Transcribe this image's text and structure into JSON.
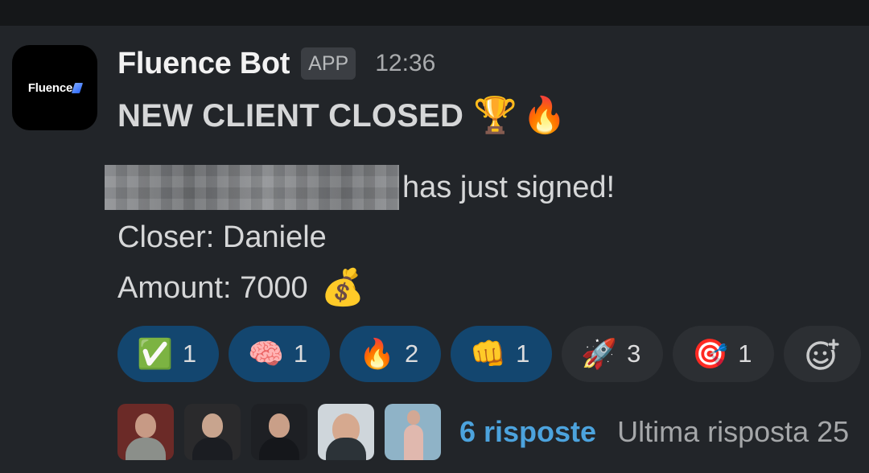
{
  "message": {
    "logo_text": "Fluence",
    "sender": "Fluence Bot",
    "badge": "APP",
    "time": "12:36",
    "headline": "NEW CLIENT CLOSED",
    "headline_emojis": [
      "🏆",
      "🔥"
    ],
    "signed_text": "has just signed!",
    "closer_line": "Closer: Daniele",
    "amount_line": "Amount: 7000",
    "amount_emoji": "💰"
  },
  "reactions": [
    {
      "emoji": "✅",
      "count": "1",
      "active": true
    },
    {
      "emoji": "🧠",
      "count": "1",
      "active": true
    },
    {
      "emoji": "🔥",
      "count": "2",
      "active": true
    },
    {
      "emoji": "👊",
      "count": "1",
      "active": true
    },
    {
      "emoji": "🚀",
      "count": "3",
      "active": false
    },
    {
      "emoji": "🎯",
      "count": "1",
      "active": false
    }
  ],
  "add_reaction_icon": "add-emoji-icon",
  "thread": {
    "replies": "6 risposte",
    "last_reply": "Ultima risposta 25"
  },
  "colors": {
    "background": "#222529",
    "active_reaction": "#13466f",
    "link": "#4ca3dd"
  }
}
